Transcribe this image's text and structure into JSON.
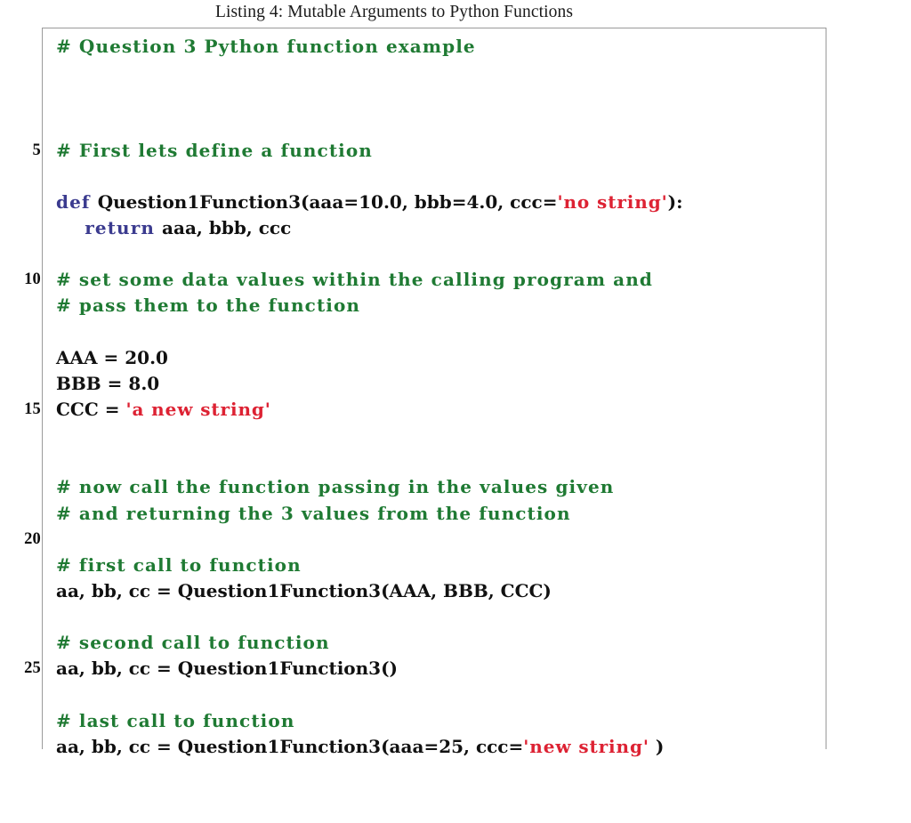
{
  "caption": {
    "text": "Listing 4: Mutable Arguments to Python Functions"
  },
  "colors": {
    "comment": "#1f7a33",
    "keyword": "#3b3b8f",
    "string": "#dd2233",
    "text": "#111111",
    "frame": "#9a9a9a",
    "background": "#ffffff"
  },
  "listing": {
    "language": "Python",
    "line_numbers_shown": [
      "5",
      "10",
      "15",
      "20",
      "25"
    ],
    "line_number_interval": 5,
    "lines": [
      {
        "n": "1",
        "num": "",
        "tokens": [
          {
            "t": "comment",
            "s": "# Question 3 Python function example"
          }
        ]
      },
      {
        "n": "2",
        "num": "",
        "tokens": []
      },
      {
        "n": "3",
        "num": "",
        "tokens": []
      },
      {
        "n": "4",
        "num": "",
        "tokens": []
      },
      {
        "n": "5",
        "num": "5",
        "tokens": [
          {
            "t": "comment",
            "s": "# First lets define a function"
          }
        ]
      },
      {
        "n": "6",
        "num": "",
        "tokens": []
      },
      {
        "n": "7",
        "num": "",
        "tokens": [
          {
            "t": "keyword",
            "s": "def "
          },
          {
            "t": "text",
            "s": "Question1Function3(aaa=10.0, bbb=4.0, ccc="
          },
          {
            "t": "string",
            "s": "'no string'"
          },
          {
            "t": "text",
            "s": "):"
          }
        ]
      },
      {
        "n": "8",
        "num": "",
        "tokens": [
          {
            "t": "keyword",
            "s": "    return "
          },
          {
            "t": "text",
            "s": "aaa, bbb, ccc"
          }
        ]
      },
      {
        "n": "9",
        "num": "",
        "tokens": []
      },
      {
        "n": "10",
        "num": "10",
        "tokens": [
          {
            "t": "comment",
            "s": "# set some data values within the calling program and"
          }
        ]
      },
      {
        "n": "11",
        "num": "",
        "tokens": [
          {
            "t": "comment",
            "s": "# pass them to the function"
          }
        ]
      },
      {
        "n": "12",
        "num": "",
        "tokens": []
      },
      {
        "n": "13",
        "num": "",
        "tokens": [
          {
            "t": "text",
            "s": "AAA = 20.0"
          }
        ]
      },
      {
        "n": "14",
        "num": "",
        "tokens": [
          {
            "t": "text",
            "s": "BBB = 8.0"
          }
        ]
      },
      {
        "n": "15",
        "num": "15",
        "tokens": [
          {
            "t": "text",
            "s": "CCC = "
          },
          {
            "t": "string",
            "s": "'a new string'"
          }
        ]
      },
      {
        "n": "16",
        "num": "",
        "tokens": []
      },
      {
        "n": "17",
        "num": "",
        "tokens": []
      },
      {
        "n": "18",
        "num": "",
        "tokens": [
          {
            "t": "comment",
            "s": "# now call the function passing in the values given"
          }
        ]
      },
      {
        "n": "19",
        "num": "",
        "tokens": [
          {
            "t": "comment",
            "s": "# and returning the 3 values from the function"
          }
        ]
      },
      {
        "n": "20",
        "num": "20",
        "tokens": []
      },
      {
        "n": "21",
        "num": "",
        "tokens": [
          {
            "t": "comment",
            "s": "# first call to function"
          }
        ]
      },
      {
        "n": "22",
        "num": "",
        "tokens": [
          {
            "t": "text",
            "s": "aa, bb, cc = Question1Function3(AAA, BBB, CCC)"
          }
        ]
      },
      {
        "n": "23",
        "num": "",
        "tokens": []
      },
      {
        "n": "24",
        "num": "",
        "tokens": [
          {
            "t": "comment",
            "s": "# second call to function"
          }
        ]
      },
      {
        "n": "25",
        "num": "25",
        "tokens": [
          {
            "t": "text",
            "s": "aa, bb, cc = Question1Function3()"
          }
        ]
      },
      {
        "n": "26",
        "num": "",
        "tokens": []
      },
      {
        "n": "27",
        "num": "",
        "tokens": [
          {
            "t": "comment",
            "s": "# last call to function"
          }
        ]
      },
      {
        "n": "28",
        "num": "",
        "tokens": [
          {
            "t": "text",
            "s": "aa, bb, cc = Question1Function3(aaa=25, ccc="
          },
          {
            "t": "string",
            "s": "'new string'"
          },
          {
            "t": "text",
            "s": " )"
          }
        ]
      }
    ]
  }
}
